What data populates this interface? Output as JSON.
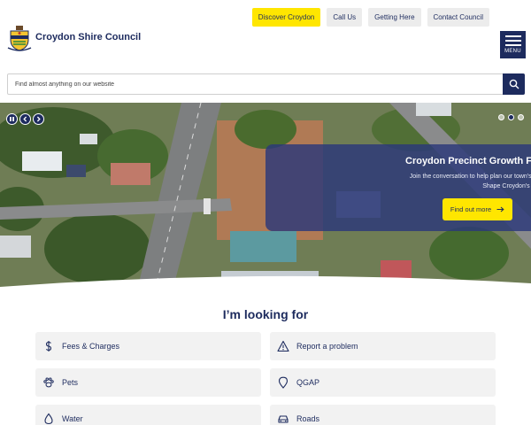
{
  "header": {
    "site_name": "Croydon Shire Council",
    "top_links": [
      {
        "label": "Discover Croydon",
        "primary": true
      },
      {
        "label": "Call Us",
        "primary": false
      },
      {
        "label": "Getting Here",
        "primary": false
      },
      {
        "label": "Contact Council",
        "primary": false
      }
    ],
    "menu_label": "MENU"
  },
  "search": {
    "placeholder": "Find almost anything on our website",
    "icon": "search-icon"
  },
  "hero": {
    "controls": [
      "pause-icon",
      "chevron-left-icon",
      "chevron-right-icon"
    ],
    "slide_count": 3,
    "active_slide": 2,
    "promo": {
      "title": "Croydon Precinct Growth F",
      "text_line1": "Join the conversation to help plan our town's growth over the next",
      "text_line2": "Shape Croydon's Future - Have Your S",
      "button_label": "Find out more"
    }
  },
  "looking_for": {
    "title": "I’m looking for",
    "items": [
      {
        "label": "Fees & Charges",
        "icon": "dollar-icon"
      },
      {
        "label": "Report a problem",
        "icon": "warning-icon"
      },
      {
        "label": "Pets",
        "icon": "paw-icon"
      },
      {
        "label": "QGAP",
        "icon": "location-pin-icon"
      },
      {
        "label": "Water",
        "icon": "water-drop-icon"
      },
      {
        "label": "Roads",
        "icon": "car-icon"
      }
    ]
  },
  "colors": {
    "navy": "#1d2b5e",
    "accent_yellow": "#ffe600",
    "tile_bg": "#f2f2f2"
  }
}
